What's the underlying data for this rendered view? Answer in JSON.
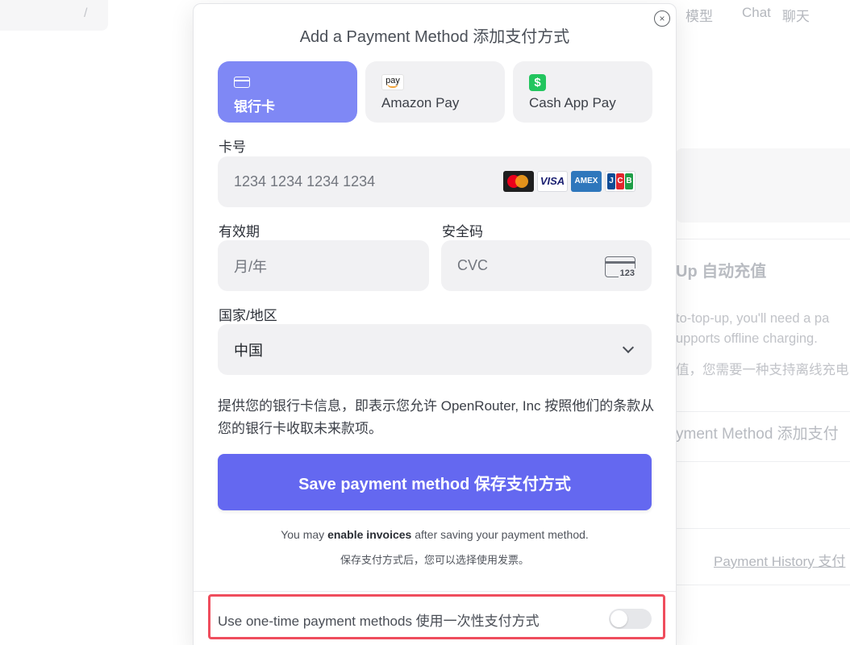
{
  "background": {
    "breadcrumb_sep": "/",
    "nav": [
      {
        "label": "模型"
      },
      {
        "label": "Chat",
        "label_cn": "聊天"
      }
    ],
    "auto_topup_title": "Up 自动充值",
    "auto_topup_desc_1": "to-top-up, you'll need a pa",
    "auto_topup_desc_2": "upports offline charging.",
    "auto_topup_desc_cn": "值，您需要一种支持离线充电",
    "add_method_text": "yment Method   添加支付",
    "payment_history_link": "Payment History 支付"
  },
  "modal": {
    "close_icon": "×",
    "title": "Add a Payment Method  添加支付方式",
    "tabs": [
      {
        "label": "银行卡",
        "icon": "card-icon",
        "active": true
      },
      {
        "label": "Amazon Pay",
        "icon": "amazon-pay-icon",
        "icon_text": "pay",
        "active": false
      },
      {
        "label": "Cash App Pay",
        "icon": "cash-app-icon",
        "icon_text": "$",
        "active": false
      }
    ],
    "card_number": {
      "label": "卡号",
      "placeholder": "1234 1234 1234 1234"
    },
    "card_brands": [
      {
        "name": "mastercard-icon"
      },
      {
        "name": "visa-icon",
        "text": "VISA"
      },
      {
        "name": "amex-icon",
        "text": "AMEX"
      },
      {
        "name": "jcb-icon",
        "text_j": "J",
        "text_c": "C",
        "text_b": "B"
      }
    ],
    "expiry": {
      "label": "有效期",
      "placeholder": "月/年"
    },
    "cvc": {
      "label": "安全码",
      "placeholder": "CVC",
      "icon_text": "123"
    },
    "country": {
      "label": "国家/地区",
      "value": "中国"
    },
    "terms_text": "提供您的银行卡信息，即表示您允许 OpenRouter, Inc 按照他们的条款从您的银行卡收取未来款项。",
    "save_button": "Save payment method  保存支付方式",
    "invoice_before": "You may ",
    "invoice_bold": "enable invoices",
    "invoice_after": " after saving your payment method.",
    "invoice_cn": "保存支付方式后，您可以选择使用发票。",
    "one_time_label": "Use one-time payment methods   使用一次性支付方式",
    "one_time_enabled": false
  },
  "colors": {
    "accent": "#6468f0",
    "tab_active": "#7f88f5",
    "highlight_border": "#ef4d5d"
  }
}
